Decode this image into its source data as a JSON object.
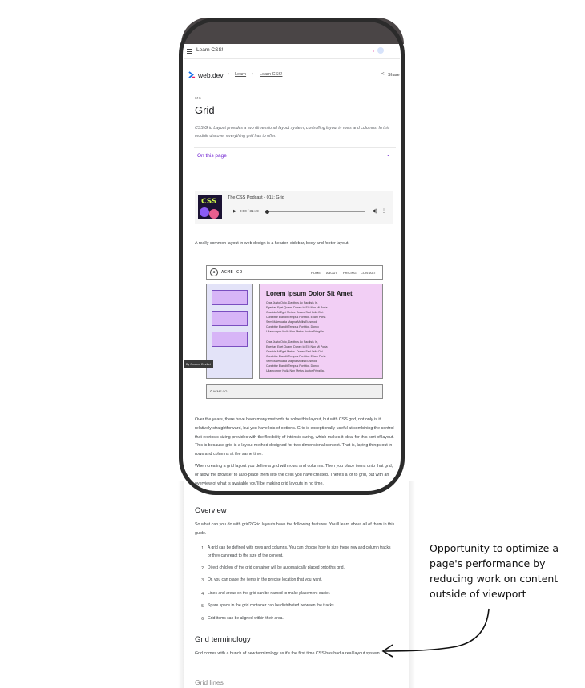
{
  "topbar": {
    "title": "Learn CSS!"
  },
  "site": {
    "name": "web.dev",
    "breadcrumb": [
      "Learn",
      "Learn CSS!"
    ],
    "share": "Share"
  },
  "article": {
    "section_number": "010",
    "title": "Grid",
    "intro": "CSS Grid Layout provides a two dimensional layout system, controlling layout in rows and columns. In this module discover everything grid has to offer.",
    "on_this_page": "On this page",
    "podcast": {
      "art_text": "CSS",
      "title": "The CSS Podcast - 011: Grid",
      "time": "0:00 / 31:49"
    },
    "lead": "A really common layout in web design is a header, sidebar, body and footer layout.",
    "para1": "Over the years, there have been many methods to solve this layout, but with CSS grid, not only is it relatively straightforward, but you have lots of options. Grid is exceptionally useful at combining the control that extrinsic sizing provides with the flexibility of intrinsic sizing, which makes it ideal for this sort of layout. This is because grid is a layout method designed for two-dimensional content. That is, laying things out in rows and columns at the same time.",
    "para2": "When creating a grid layout you define a grid with rows and columns. Then you place items onto that grid, or allow the browser to auto-place them into the cells you have created. There's a lot to grid, but with an overview of what is available you'll be making grid layouts in no time.",
    "overview_heading": "Overview",
    "overview_intro": "So what can you do with grid? Grid layouts have the following features. You'll learn about all of them in this guide.",
    "overview_items": [
      "A grid can be defined with rows and columns. You can choose how to size these row and column tracks or they can react to the size of the content.",
      "Direct children of the grid container will be automatically placed onto this grid.",
      "Or, you can place the items in the precise location that you want.",
      "Lines and areas on the grid can be named to make placement easier.",
      "Spare space in the grid container can be distributed between the tracks.",
      "Grid items can be aligned within their area."
    ],
    "terminology_heading": "Grid terminology",
    "terminology_text": "Grid comes with a bunch of new terminology as it's the first time CSS has had a real layout system.",
    "next_heading": "Grid lines"
  },
  "demo": {
    "logo_letter": "a",
    "brand": "ACME CO",
    "nav": [
      "HOME",
      "ABOUT",
      "PRICING",
      "CONTACT"
    ],
    "heading": "Lorem Ipsum Dolor Sit Amet",
    "para1": "Cras Justo Odio, Dapibus Ac Facilisis In,\nEgestas Eget Quam. Donec Id Elit Non Mi Porta\nGravida At Eget Metus. Donec Sed Odio Dui.\nCurabitur Blandit Tempus Porttitor. Etiam Porta\nSem Malesuada Magna Mollis Euismod.\nCurabitur Blandit Tempus Porttitor. Donec\nUllamcorper Nulla Non Metus Auctor Fringilla.",
    "para2": "Cras Justo Odio, Dapibus Ac Facilisis In,\nEgestas Eget Quam. Donec Id Elit Non Mi Porta\nGravida At Eget Metus. Donec Sed Odio Dui.\nCurabitur Blandit Tempus Porttitor. Etiam Porta\nSem Malesuada Magna Mollis Euismod.\nCurabitur Blandit Tempus Porttitor. Donec\nUllamcorper Nulla Non Metus Auctor Fringilla.",
    "footer": "© ACME CO",
    "attribution": "By Ornamo Devillet"
  },
  "annotation": {
    "text": "Opportunity to optimize a page's performance by reducing work on content outside of viewport"
  },
  "colors": {
    "accent": "#6e1fd0",
    "phone_frame": "#2b2b2b",
    "demo_main": "#f2cff5",
    "demo_sidebar": "#e3e3f8",
    "demo_box": "#d7b5f7"
  }
}
